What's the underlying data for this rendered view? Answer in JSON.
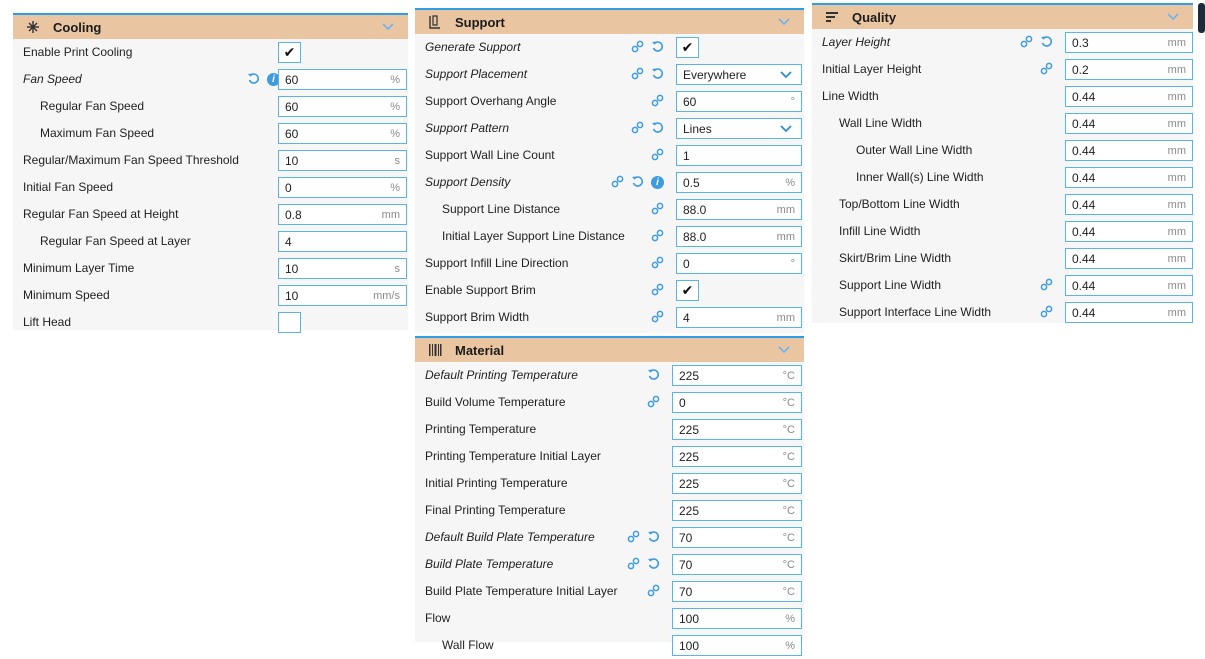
{
  "cooling": {
    "title": "Cooling",
    "rows": [
      {
        "label": "Enable Print Cooling",
        "type": "check",
        "checked": true
      },
      {
        "label": "Fan Speed",
        "italic": true,
        "value": "60",
        "unit": "%",
        "icons": [
          "reset",
          "info"
        ]
      },
      {
        "label": "Regular Fan Speed",
        "indent": 1,
        "value": "60",
        "unit": "%"
      },
      {
        "label": "Maximum Fan Speed",
        "indent": 1,
        "value": "60",
        "unit": "%"
      },
      {
        "label": "Regular/Maximum Fan Speed Threshold",
        "value": "10",
        "unit": "s"
      },
      {
        "label": "Initial Fan Speed",
        "value": "0",
        "unit": "%"
      },
      {
        "label": "Regular Fan Speed at Height",
        "value": "0.8",
        "unit": "mm"
      },
      {
        "label": "Regular Fan Speed at Layer",
        "indent": 1,
        "value": "4",
        "unit": ""
      },
      {
        "label": "Minimum Layer Time",
        "value": "10",
        "unit": "s"
      },
      {
        "label": "Minimum Speed",
        "value": "10",
        "unit": "mm/s"
      },
      {
        "label": "Lift Head",
        "type": "check",
        "checked": false
      }
    ]
  },
  "support": {
    "title": "Support",
    "rows": [
      {
        "label": "Generate Support",
        "italic": true,
        "type": "check",
        "checked": true,
        "icons": [
          "link",
          "reset"
        ]
      },
      {
        "label": "Support Placement",
        "italic": true,
        "type": "combo",
        "value": "Everywhere",
        "icons": [
          "link",
          "reset"
        ]
      },
      {
        "label": "Support Overhang Angle",
        "value": "60",
        "unit": "°",
        "icons": [
          "link"
        ]
      },
      {
        "label": "Support Pattern",
        "italic": true,
        "type": "combo",
        "value": "Lines",
        "icons": [
          "link",
          "reset"
        ]
      },
      {
        "label": "Support Wall Line Count",
        "value": "1",
        "unit": "",
        "icons": [
          "link"
        ]
      },
      {
        "label": "Support Density",
        "italic": true,
        "value": "0.5",
        "unit": "%",
        "icons": [
          "link",
          "reset",
          "info"
        ]
      },
      {
        "label": "Support Line Distance",
        "indent": 1,
        "value": "88.0",
        "unit": "mm",
        "icons": [
          "link"
        ]
      },
      {
        "label": "Initial Layer Support Line Distance",
        "indent": 1,
        "value": "88.0",
        "unit": "mm",
        "icons": [
          "link"
        ]
      },
      {
        "label": "Support Infill Line Direction",
        "value": "0",
        "unit": "°",
        "icons": [
          "link"
        ]
      },
      {
        "label": "Enable Support Brim",
        "type": "check",
        "checked": true,
        "icons": [
          "link"
        ]
      },
      {
        "label": "Support Brim Width",
        "value": "4",
        "unit": "mm",
        "icons": [
          "link"
        ]
      }
    ]
  },
  "quality": {
    "title": "Quality",
    "rows": [
      {
        "label": "Layer Height",
        "italic": true,
        "value": "0.3",
        "unit": "mm",
        "icons": [
          "link",
          "reset"
        ]
      },
      {
        "label": "Initial Layer Height",
        "value": "0.2",
        "unit": "mm",
        "icons": [
          "link"
        ]
      },
      {
        "label": "Line Width",
        "value": "0.44",
        "unit": "mm"
      },
      {
        "label": "Wall Line Width",
        "indent": 1,
        "value": "0.44",
        "unit": "mm"
      },
      {
        "label": "Outer Wall Line Width",
        "indent": 2,
        "value": "0.44",
        "unit": "mm"
      },
      {
        "label": "Inner Wall(s) Line Width",
        "indent": 2,
        "value": "0.44",
        "unit": "mm"
      },
      {
        "label": "Top/Bottom Line Width",
        "indent": 1,
        "value": "0.44",
        "unit": "mm"
      },
      {
        "label": "Infill Line Width",
        "indent": 1,
        "value": "0.44",
        "unit": "mm"
      },
      {
        "label": "Skirt/Brim Line Width",
        "indent": 1,
        "value": "0.44",
        "unit": "mm"
      },
      {
        "label": "Support Line Width",
        "indent": 1,
        "value": "0.44",
        "unit": "mm",
        "icons": [
          "link"
        ]
      },
      {
        "label": "Support Interface Line Width",
        "indent": 1,
        "value": "0.44",
        "unit": "mm",
        "icons": [
          "link"
        ]
      }
    ]
  },
  "material": {
    "title": "Material",
    "rows": [
      {
        "label": "Default Printing Temperature",
        "italic": true,
        "value": "225",
        "unit": "°C",
        "icons": [
          "reset"
        ]
      },
      {
        "label": "Build Volume Temperature",
        "value": "0",
        "unit": "°C",
        "icons": [
          "link"
        ]
      },
      {
        "label": "Printing Temperature",
        "value": "225",
        "unit": "°C"
      },
      {
        "label": "Printing Temperature Initial Layer",
        "value": "225",
        "unit": "°C"
      },
      {
        "label": "Initial Printing Temperature",
        "value": "225",
        "unit": "°C"
      },
      {
        "label": "Final Printing Temperature",
        "value": "225",
        "unit": "°C"
      },
      {
        "label": "Default Build Plate Temperature",
        "italic": true,
        "value": "70",
        "unit": "°C",
        "icons": [
          "link",
          "reset"
        ]
      },
      {
        "label": "Build Plate Temperature",
        "italic": true,
        "value": "70",
        "unit": "°C",
        "icons": [
          "link",
          "reset"
        ]
      },
      {
        "label": "Build Plate Temperature Initial Layer",
        "value": "70",
        "unit": "°C",
        "icons": [
          "link"
        ]
      },
      {
        "label": "Flow",
        "value": "100",
        "unit": "%"
      },
      {
        "label": "Wall Flow",
        "indent": 1,
        "value": "100",
        "unit": "%"
      }
    ]
  },
  "colors": {
    "header": "#e9c5a2",
    "accent": "#3d9be0",
    "panel": "#f6f6f6"
  },
  "icons": {
    "link": "link-icon",
    "reset": "reset-icon",
    "info": "info-icon",
    "chevron": "chevron-down-icon"
  }
}
